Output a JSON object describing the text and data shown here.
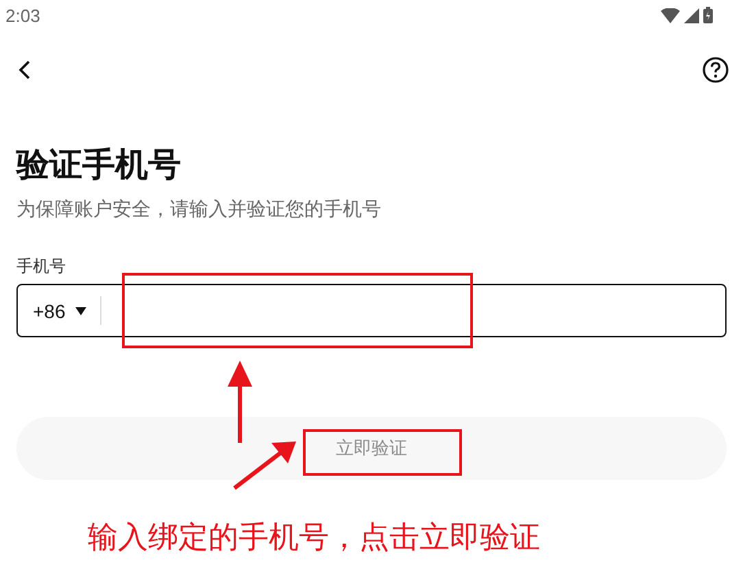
{
  "status_bar": {
    "time": "2:03"
  },
  "title": "验证手机号",
  "subtitle": "为保障账户安全，请输入并验证您的手机号",
  "phone_field": {
    "label": "手机号",
    "country_code": "+86"
  },
  "submit_button": {
    "label": "立即验证",
    "disabled": true
  },
  "annotation": {
    "note": "输入绑定的手机号，点击立即验证"
  }
}
